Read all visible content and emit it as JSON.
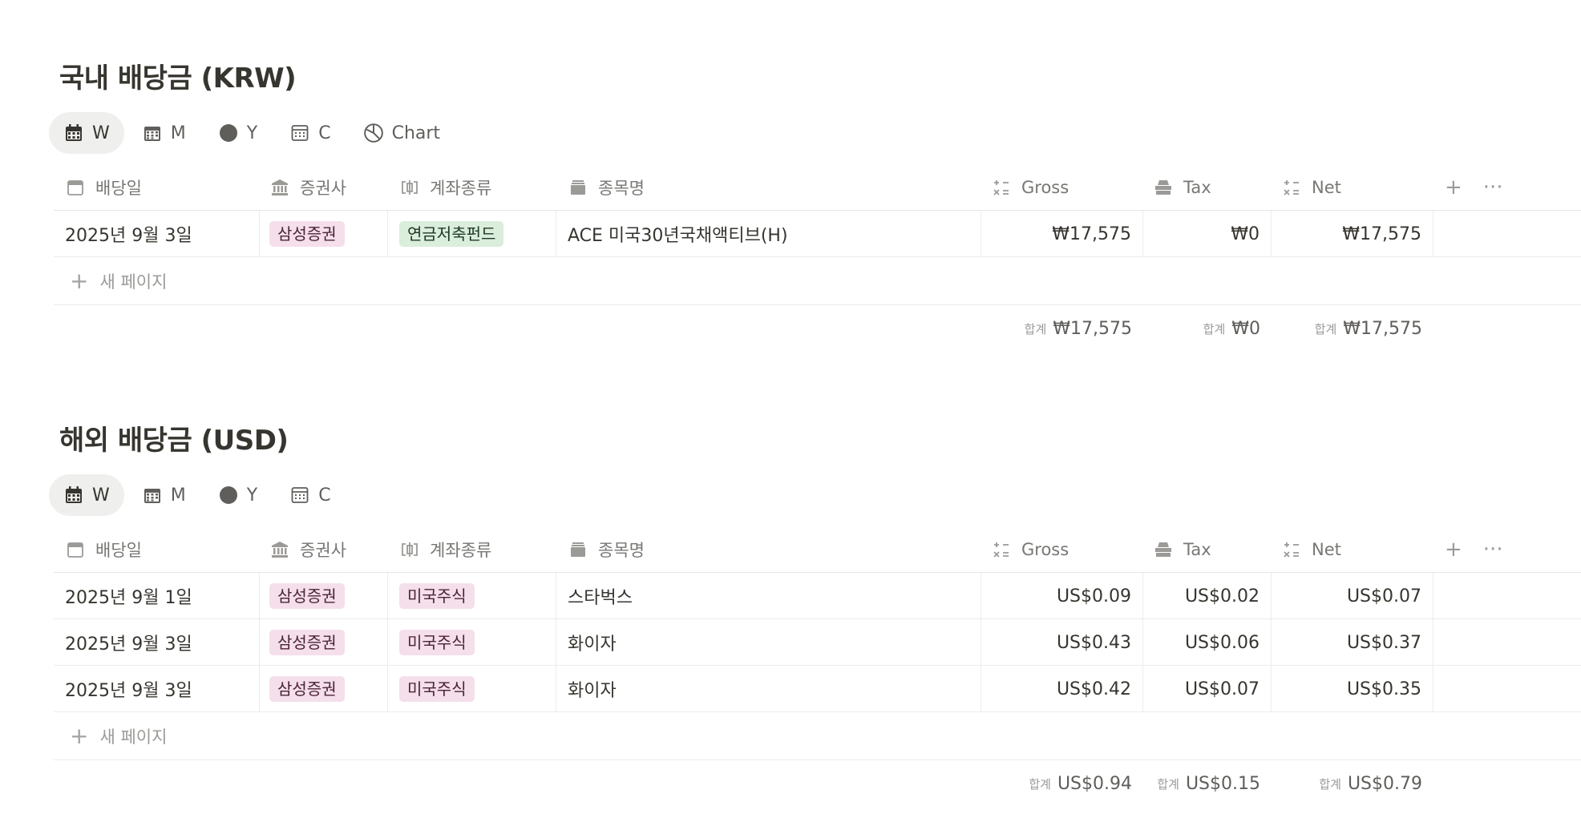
{
  "krw": {
    "title": "국내 배당금 (KRW)",
    "views": [
      {
        "label": "W",
        "icon": "calendar-icon",
        "active": true
      },
      {
        "label": "M",
        "icon": "calendar-grid-icon",
        "active": false
      },
      {
        "label": "Y",
        "icon": "circle-icon",
        "active": false
      },
      {
        "label": "C",
        "icon": "calculator-icon",
        "active": false
      },
      {
        "label": "Chart",
        "icon": "pie-chart-icon",
        "active": false
      }
    ],
    "columns": {
      "date": "배당일",
      "broker": "증권사",
      "account": "계좌종류",
      "name": "종목명",
      "gross": "Gross",
      "tax": "Tax",
      "net": "Net"
    },
    "rows": [
      {
        "date": "2025년 9월 3일",
        "broker": "삼성증권",
        "account": "연금저축펀드",
        "account_color": "green",
        "name": "ACE 미국30년국채액티브(H)",
        "gross": "₩17,575",
        "tax": "₩0",
        "net": "₩17,575"
      }
    ],
    "new_page": "새 페이지",
    "sum_label": "합계",
    "sums": {
      "gross": "₩17,575",
      "tax": "₩0",
      "net": "₩17,575"
    }
  },
  "usd": {
    "title": "해외 배당금 (USD)",
    "views": [
      {
        "label": "W",
        "icon": "calendar-icon",
        "active": true
      },
      {
        "label": "M",
        "icon": "calendar-grid-icon",
        "active": false
      },
      {
        "label": "Y",
        "icon": "circle-icon",
        "active": false
      },
      {
        "label": "C",
        "icon": "calculator-icon",
        "active": false
      }
    ],
    "columns": {
      "date": "배당일",
      "broker": "증권사",
      "account": "계좌종류",
      "name": "종목명",
      "gross": "Gross",
      "tax": "Tax",
      "net": "Net"
    },
    "rows": [
      {
        "date": "2025년 9월 1일",
        "broker": "삼성증권",
        "account": "미국주식",
        "account_color": "pink",
        "name": "스타벅스",
        "gross": "US$0.09",
        "tax": "US$0.02",
        "net": "US$0.07"
      },
      {
        "date": "2025년 9월 3일",
        "broker": "삼성증권",
        "account": "미국주식",
        "account_color": "pink",
        "name": "화이자",
        "gross": "US$0.43",
        "tax": "US$0.06",
        "net": "US$0.37"
      },
      {
        "date": "2025년 9월 3일",
        "broker": "삼성증권",
        "account": "미국주식",
        "account_color": "pink",
        "name": "화이자",
        "gross": "US$0.42",
        "tax": "US$0.07",
        "net": "US$0.35"
      }
    ],
    "new_page": "새 페이지",
    "sum_label": "합계",
    "sums": {
      "gross": "US$0.94",
      "tax": "US$0.15",
      "net": "US$0.79"
    }
  }
}
